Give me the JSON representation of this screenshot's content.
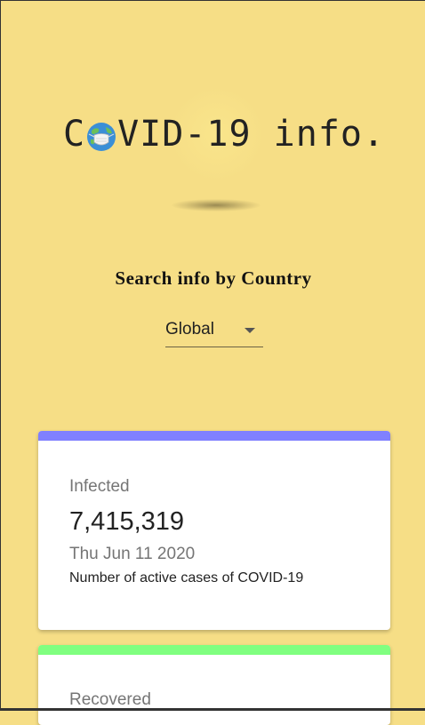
{
  "logo": {
    "prefix": "C",
    "suffix": "VID-19 info."
  },
  "heading": "Search info by Country",
  "country_select": {
    "value": "Global"
  },
  "cards": [
    {
      "title": "Infected",
      "value": "7,415,319",
      "date": "Thu Jun 11 2020",
      "description": "Number of active cases of COVID-19",
      "accent_color": "#8080ff"
    },
    {
      "title": "Recovered",
      "accent_color": "#80ff80"
    }
  ],
  "colors": {
    "background": "#f6de86"
  }
}
